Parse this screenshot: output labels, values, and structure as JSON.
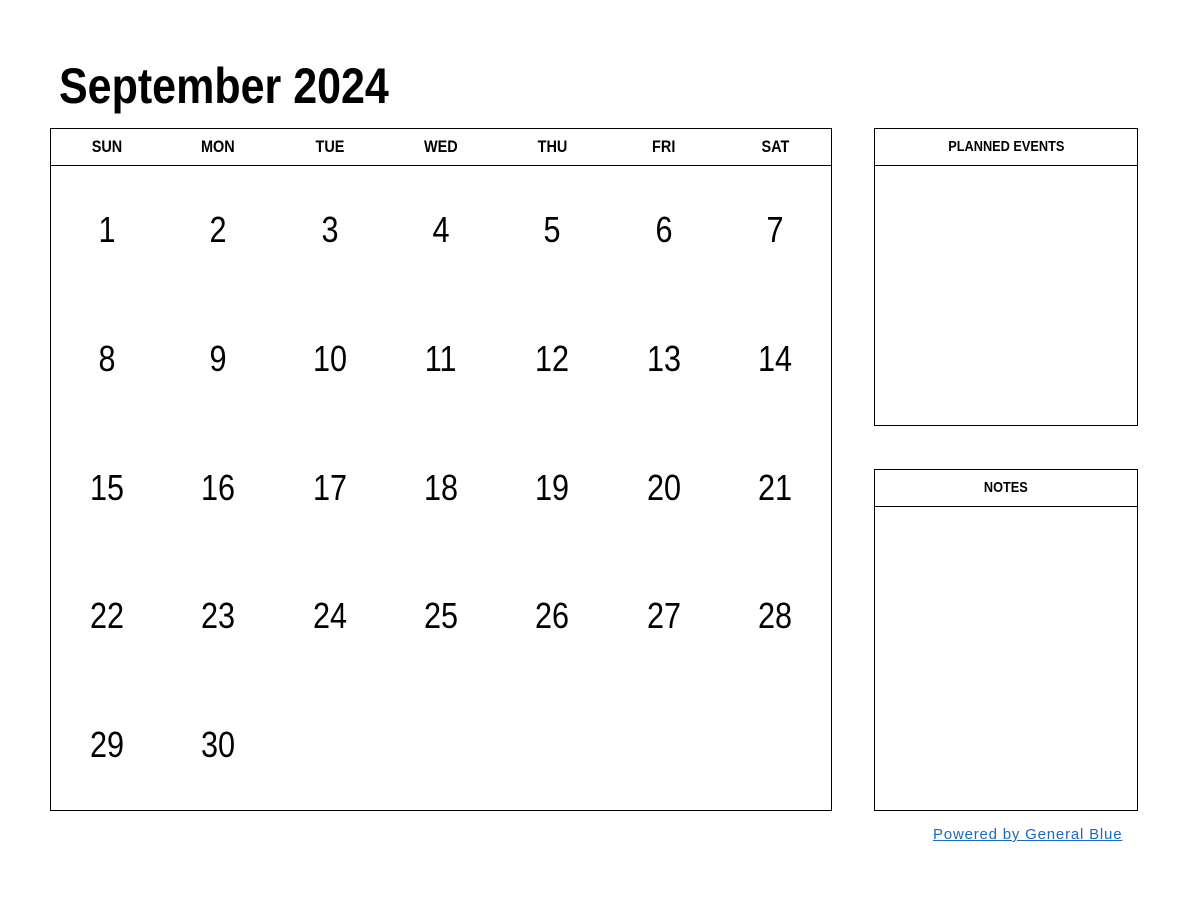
{
  "title": "September 2024",
  "weekdays": [
    "SUN",
    "MON",
    "TUE",
    "WED",
    "THU",
    "FRI",
    "SAT"
  ],
  "days": [
    [
      "1",
      "2",
      "3",
      "4",
      "5",
      "6",
      "7"
    ],
    [
      "8",
      "9",
      "10",
      "11",
      "12",
      "13",
      "14"
    ],
    [
      "15",
      "16",
      "17",
      "18",
      "19",
      "20",
      "21"
    ],
    [
      "22",
      "23",
      "24",
      "25",
      "26",
      "27",
      "28"
    ],
    [
      "29",
      "30",
      "",
      "",
      "",
      "",
      ""
    ]
  ],
  "planned_events": {
    "title": "PLANNED EVENTS"
  },
  "notes": {
    "title": "NOTES"
  },
  "footer": {
    "link_text": "Powered by General Blue",
    "link_color": "#1a6bbf"
  }
}
